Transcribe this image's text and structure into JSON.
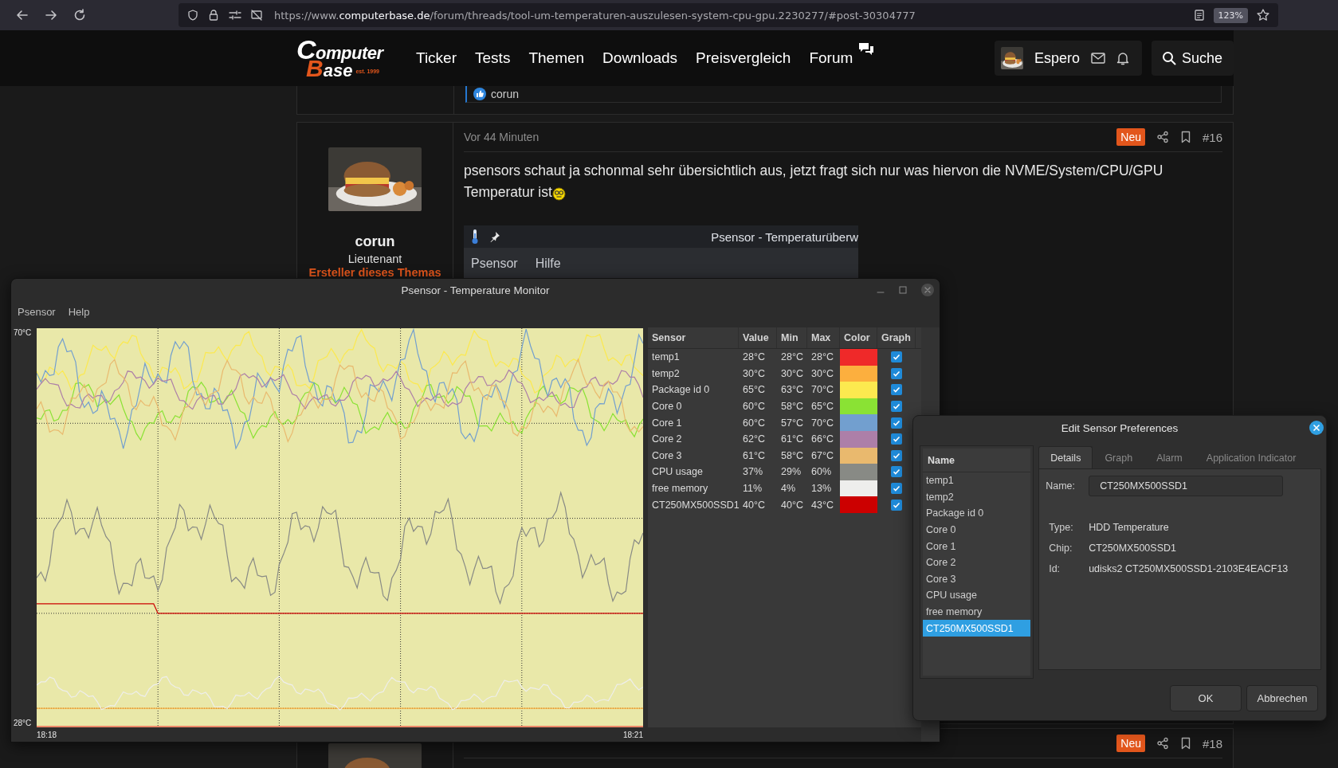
{
  "browser": {
    "url": {
      "prefix": "https://www.",
      "domain": "computerbase.de",
      "path": "/forum/threads/tool-um-temperaturen-auszulesen-system-cpu-gpu.2230277/#post-30304777"
    },
    "zoom": "123%"
  },
  "site": {
    "logo": {
      "line1": "Computer",
      "line2": "Base",
      "tag": "est. 1999"
    },
    "nav": [
      "Ticker",
      "Tests",
      "Themen",
      "Downloads",
      "Preisvergleich",
      "Forum"
    ],
    "user": "Espero",
    "search": "Suche"
  },
  "prev_post": {
    "reaction_user": "corun"
  },
  "post": {
    "author": "corun",
    "rank": "Lieutenant",
    "role": "Ersteller dieses Themas",
    "time": "Vor 44 Minuten",
    "badge": "Neu",
    "number": "#16",
    "text_lines": [
      "psensors schaut ja schonmal sehr übersichtlich aus, jetzt fragt sich nur was hiervon die NVME/System/CPU/GPU",
      "Temperatur ist"
    ],
    "embed": {
      "title": "Psensor - Temperaturüberw",
      "menu": [
        "Psensor",
        "Hilfe"
      ]
    }
  },
  "next_post": {
    "badge": "Neu",
    "number": "#18"
  },
  "psensor": {
    "title": "Psensor - Temperature Monitor",
    "menu": [
      "Psensor",
      "Help"
    ],
    "graph": {
      "y_max": "70°C",
      "y_min": "28°C",
      "x_start": "18:18",
      "x_end": "18:21"
    },
    "columns": [
      "Sensor",
      "Value",
      "Min",
      "Max",
      "Color",
      "Graph"
    ],
    "sensors": [
      {
        "name": "temp1",
        "value": "28°C",
        "min": "28°C",
        "max": "28°C",
        "color": "#ef2929",
        "graph": true
      },
      {
        "name": "temp2",
        "value": "30°C",
        "min": "30°C",
        "max": "30°C",
        "color": "#fcaf3e",
        "graph": true
      },
      {
        "name": "Package id 0",
        "value": "65°C",
        "min": "63°C",
        "max": "70°C",
        "color": "#fce94f",
        "graph": true
      },
      {
        "name": "Core 0",
        "value": "60°C",
        "min": "58°C",
        "max": "65°C",
        "color": "#8ae234",
        "graph": true
      },
      {
        "name": "Core 1",
        "value": "60°C",
        "min": "57°C",
        "max": "70°C",
        "color": "#729fcf",
        "graph": true
      },
      {
        "name": "Core 2",
        "value": "62°C",
        "min": "61°C",
        "max": "66°C",
        "color": "#ad7fa8",
        "graph": true
      },
      {
        "name": "Core 3",
        "value": "61°C",
        "min": "58°C",
        "max": "67°C",
        "color": "#e9b96e",
        "graph": true
      },
      {
        "name": "CPU usage",
        "value": "37%",
        "min": "29%",
        "max": "60%",
        "color": "#888a85",
        "graph": true
      },
      {
        "name": "free memory",
        "value": "11%",
        "min": "4%",
        "max": "13%",
        "color": "#eeeeec",
        "graph": true
      },
      {
        "name": "CT250MX500SSD1",
        "value": "40°C",
        "min": "40°C",
        "max": "43°C",
        "color": "#cc0000",
        "graph": true
      }
    ]
  },
  "dialog": {
    "title": "Edit Sensor Preferences",
    "list_header": "Name",
    "items": [
      {
        "label": "temp1",
        "selected": false
      },
      {
        "label": "temp2",
        "selected": false
      },
      {
        "label": "Package id 0",
        "selected": false
      },
      {
        "label": "Core 0",
        "selected": false
      },
      {
        "label": "Core 1",
        "selected": false
      },
      {
        "label": "Core 2",
        "selected": false
      },
      {
        "label": "Core 3",
        "selected": false
      },
      {
        "label": "CPU usage",
        "selected": false
      },
      {
        "label": "free memory",
        "selected": false
      },
      {
        "label": "CT250MX500SSD1",
        "selected": true
      }
    ],
    "tabs": [
      {
        "label": "Details",
        "selected": true
      },
      {
        "label": "Graph",
        "selected": false
      },
      {
        "label": "Alarm",
        "selected": false
      },
      {
        "label": "Application Indicator",
        "selected": false
      }
    ],
    "fields": [
      {
        "kind": "input",
        "label": "Name:",
        "value": "CT250MX500SSD1"
      },
      {
        "kind": "text",
        "label": "Type:",
        "value": "HDD Temperature"
      },
      {
        "kind": "text",
        "label": "Chip:",
        "value": "CT250MX500SSD1"
      },
      {
        "kind": "text",
        "label": "Id:",
        "value": "udisks2 CT250MX500SSD1-2103E4EACF13"
      }
    ],
    "buttons": [
      "OK",
      "Abbrechen"
    ]
  }
}
